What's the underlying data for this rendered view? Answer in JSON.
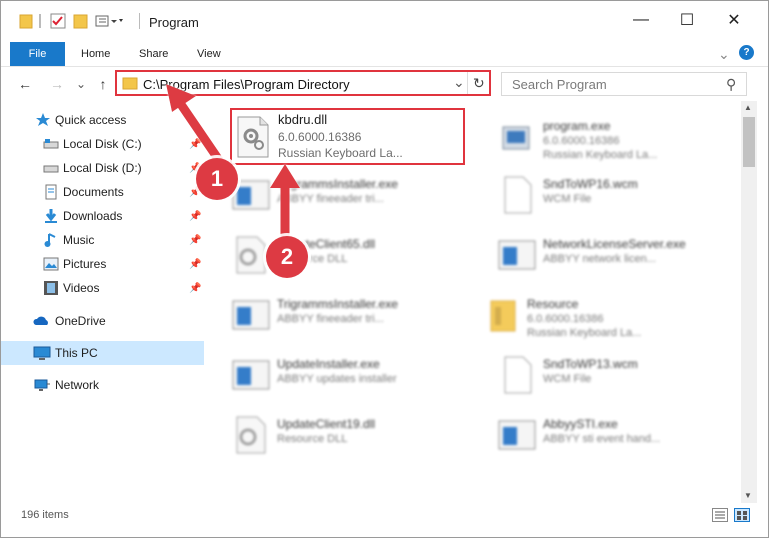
{
  "window": {
    "title": "Program",
    "minimize_glyph": "—",
    "maximize_glyph": "☐",
    "close_glyph": "✕"
  },
  "ribbon": {
    "tabs": [
      "File",
      "Home",
      "Share",
      "View"
    ],
    "help_glyph": "?",
    "expand_glyph": "⌄"
  },
  "nav": {
    "back": "←",
    "forward": "→",
    "recent": "⌄",
    "up": "↑",
    "address": "C:\\Program Files\\Program Directory",
    "refresh_glyph": "↻",
    "dropdown_glyph": "⌄",
    "search_placeholder": "Search Program",
    "search_glyph": "⚲"
  },
  "sidebar": {
    "items": [
      {
        "label": "Quick access",
        "icon": "star-icon"
      },
      {
        "label": "Local Disk (C:)",
        "icon": "drive-icon"
      },
      {
        "label": "Local Disk (D:)",
        "icon": "drive-icon"
      },
      {
        "label": "Documents",
        "icon": "documents-icon"
      },
      {
        "label": "Downloads",
        "icon": "download-icon"
      },
      {
        "label": "Music",
        "icon": "music-icon"
      },
      {
        "label": "Pictures",
        "icon": "pictures-icon"
      },
      {
        "label": "Videos",
        "icon": "videos-icon"
      },
      {
        "label": "OneDrive",
        "icon": "cloud-icon"
      },
      {
        "label": "This PC",
        "icon": "computer-icon"
      },
      {
        "label": "Network",
        "icon": "network-icon"
      }
    ],
    "pin_glyph": "📌"
  },
  "files": [
    {
      "name": "kbdru.dll",
      "line1": "6.0.6000.16386",
      "line2": "Russian Keyboard La...",
      "icon": "dll-gear-icon"
    },
    {
      "name": "program.exe",
      "line1": "6.0.6000.16386",
      "line2": "Russian Keyboard La...",
      "icon": "exe-icon"
    },
    {
      "name": "TrigrammsInstaller.exe",
      "line1": "ABBYY fineeader tri...",
      "line2": "",
      "icon": "exe-window-icon"
    },
    {
      "name": "SndToWP16.wcm",
      "line1": "WCM File",
      "line2": "",
      "icon": "blank-file-icon"
    },
    {
      "name": "UpdateClient65.dll",
      "line1": "Resource DLL",
      "line2": "",
      "icon": "dll-gear-icon"
    },
    {
      "name": "NetworkLicenseServer.exe",
      "line1": "ABBYY network licen...",
      "line2": "",
      "icon": "exe-window-icon"
    },
    {
      "name": "TrigrammsInstaller.exe",
      "line1": "ABBYY fineeader tri...",
      "line2": "",
      "icon": "exe-window-icon"
    },
    {
      "name": "Resource",
      "line1": "6.0.6000.16386",
      "line2": "Russian Keyboard La...",
      "icon": "folder-icon"
    },
    {
      "name": "UpdateInstaller.exe",
      "line1": "ABBYY updates installer",
      "line2": "",
      "icon": "exe-window-icon"
    },
    {
      "name": "SndToWP13.wcm",
      "line1": "WCM File",
      "line2": "",
      "icon": "blank-file-icon"
    },
    {
      "name": "UpdateClient19.dll",
      "line1": "Resource DLL",
      "line2": "",
      "icon": "dll-gear-icon"
    },
    {
      "name": "AbbyySTI.exe",
      "line1": "ABBYY sti event hand...",
      "line2": "",
      "icon": "exe-window-icon"
    }
  ],
  "status": {
    "count": "196 items"
  },
  "annotations": {
    "marker1": "1",
    "marker2": "2"
  },
  "colors": {
    "accent": "#1979ca",
    "highlight_border": "#e0343e",
    "selection": "#cce8ff"
  }
}
